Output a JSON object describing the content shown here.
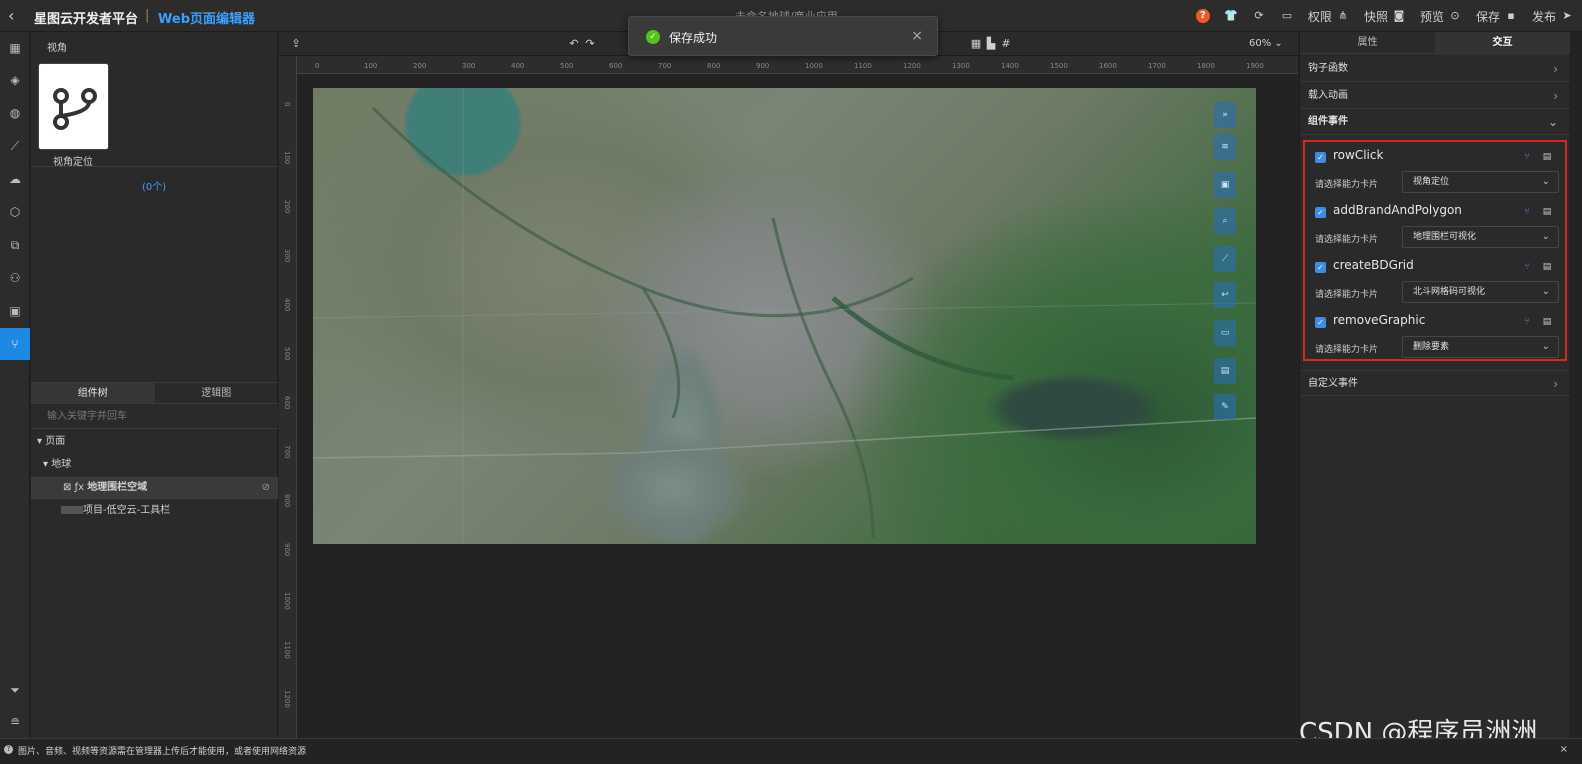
{
  "header": {
    "brand": "星图云开发者平台",
    "brand_sep": "|",
    "brand_sub": "Web页面编辑器",
    "doc_title": "未命名地球/商业应用",
    "actions": [
      {
        "label": "权限",
        "icon": "org-icon"
      },
      {
        "label": "快照",
        "icon": "camera-icon"
      },
      {
        "label": "预览",
        "icon": "eye-icon"
      },
      {
        "label": "保存",
        "icon": "save-icon"
      },
      {
        "label": "发布",
        "icon": "send-icon"
      }
    ]
  },
  "toast": {
    "text": "保存成功"
  },
  "left_panel": {
    "title": "视角",
    "card_label": "视角定位",
    "count": "(0个)",
    "tabs": [
      "组件树",
      "逻辑图"
    ],
    "search_placeholder": "输入关键字并回车",
    "tree": [
      {
        "label": "页面"
      },
      {
        "label": "地球"
      },
      {
        "label": "地理围栏空域"
      },
      {
        "label": "项目-低空云-工具栏"
      }
    ]
  },
  "canvas": {
    "zoom": "60%",
    "ruler_top": [
      "0",
      "100",
      "200",
      "300",
      "400",
      "500",
      "600",
      "700",
      "800",
      "900",
      "1000",
      "1100",
      "1200",
      "1300",
      "1400",
      "1500",
      "1600",
      "1700",
      "1800",
      "1900"
    ],
    "ruler_left": [
      "0",
      "100",
      "200",
      "300",
      "400",
      "500",
      "600",
      "700",
      "800",
      "900",
      "1000",
      "1100",
      "1200"
    ]
  },
  "right_panel": {
    "tabs": [
      "属性",
      "交互"
    ],
    "sections": {
      "hook": "钩子函数",
      "animation": "载入动画",
      "events": "组件事件",
      "custom": "自定义事件"
    },
    "select_label": "请选择能力卡片",
    "events": [
      {
        "name": "rowClick",
        "card": "视角定位"
      },
      {
        "name": "addBrandAndPolygon",
        "card": "地理围栏可视化"
      },
      {
        "name": "createBDGrid",
        "card": "北斗网格码可视化"
      },
      {
        "name": "removeGraphic",
        "card": "删除要素"
      }
    ]
  },
  "watermark": "CSDN @程序员洲洲",
  "status": {
    "text": "图片、音频、视频等资源需在管理器上传后才能使用，或者使用网络资源"
  },
  "colors": {
    "accent": "#1e88e5",
    "brand_sub": "#3aa0ff",
    "success": "#52c41a",
    "highlight_border": "#d9261c"
  }
}
